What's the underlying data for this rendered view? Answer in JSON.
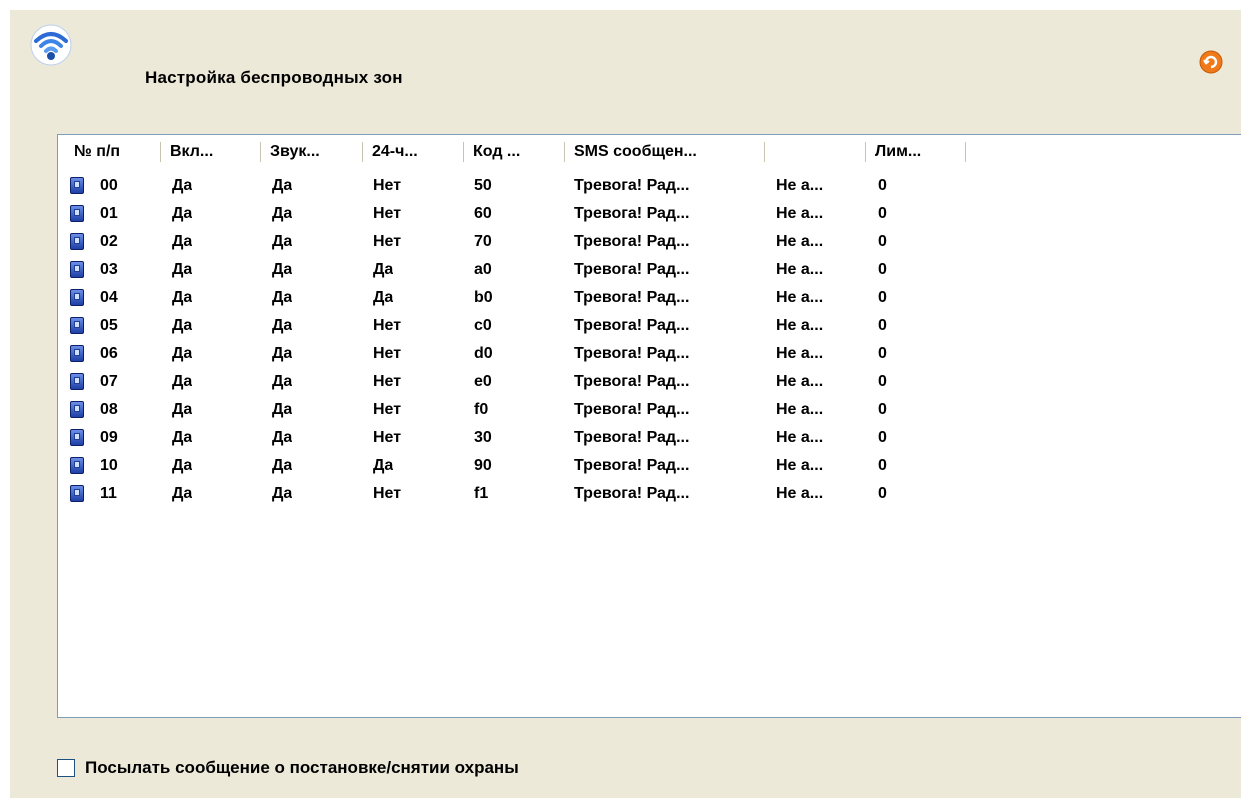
{
  "window": {
    "title": "Настройка беспроводных зон",
    "icon": "wifi-icon",
    "refresh_icon": "refresh-icon"
  },
  "list": {
    "columns": [
      "№ п/п",
      "Вкл...",
      "Звук...",
      "24-ч...",
      "Код ...",
      "SMS сообщен...",
      "",
      "Лим..."
    ],
    "rows": [
      {
        "num": "00",
        "on": "Да",
        "sound": "Да",
        "h24": "Нет",
        "code": "50",
        "sms": "Тревога! Рад...",
        "extra": "Не а...",
        "limit": "0"
      },
      {
        "num": "01",
        "on": "Да",
        "sound": "Да",
        "h24": "Нет",
        "code": "60",
        "sms": "Тревога! Рад...",
        "extra": "Не а...",
        "limit": "0"
      },
      {
        "num": "02",
        "on": "Да",
        "sound": "Да",
        "h24": "Нет",
        "code": "70",
        "sms": "Тревога! Рад...",
        "extra": "Не а...",
        "limit": "0"
      },
      {
        "num": "03",
        "on": "Да",
        "sound": "Да",
        "h24": "Да",
        "code": "a0",
        "sms": "Тревога! Рад...",
        "extra": "Не а...",
        "limit": "0"
      },
      {
        "num": "04",
        "on": "Да",
        "sound": "Да",
        "h24": "Да",
        "code": "b0",
        "sms": "Тревога! Рад...",
        "extra": "Не а...",
        "limit": "0"
      },
      {
        "num": "05",
        "on": "Да",
        "sound": "Да",
        "h24": "Нет",
        "code": "c0",
        "sms": "Тревога! Рад...",
        "extra": "Не а...",
        "limit": "0"
      },
      {
        "num": "06",
        "on": "Да",
        "sound": "Да",
        "h24": "Нет",
        "code": "d0",
        "sms": "Тревога! Рад...",
        "extra": "Не а...",
        "limit": "0"
      },
      {
        "num": "07",
        "on": "Да",
        "sound": "Да",
        "h24": "Нет",
        "code": "e0",
        "sms": "Тревога! Рад...",
        "extra": "Не а...",
        "limit": "0"
      },
      {
        "num": "08",
        "on": "Да",
        "sound": "Да",
        "h24": "Нет",
        "code": "f0",
        "sms": "Тревога! Рад...",
        "extra": "Не а...",
        "limit": "0"
      },
      {
        "num": "09",
        "on": "Да",
        "sound": "Да",
        "h24": "Нет",
        "code": "30",
        "sms": "Тревога! Рад...",
        "extra": "Не а...",
        "limit": "0"
      },
      {
        "num": "10",
        "on": "Да",
        "sound": "Да",
        "h24": "Да",
        "code": "90",
        "sms": "Тревога! Рад...",
        "extra": "Не а...",
        "limit": "0"
      },
      {
        "num": "11",
        "on": "Да",
        "sound": "Да",
        "h24": "Нет",
        "code": "f1",
        "sms": "Тревога! Рад...",
        "extra": "Не а...",
        "limit": "0"
      }
    ]
  },
  "options": {
    "arm_notify_label": "Посылать сообщение о постановке/снятии охраны",
    "arm_notify_checked": false
  },
  "colors": {
    "panel_bg": "#ece9d8",
    "list_border": "#7f9db9",
    "checkbox_border": "#1c5180"
  }
}
